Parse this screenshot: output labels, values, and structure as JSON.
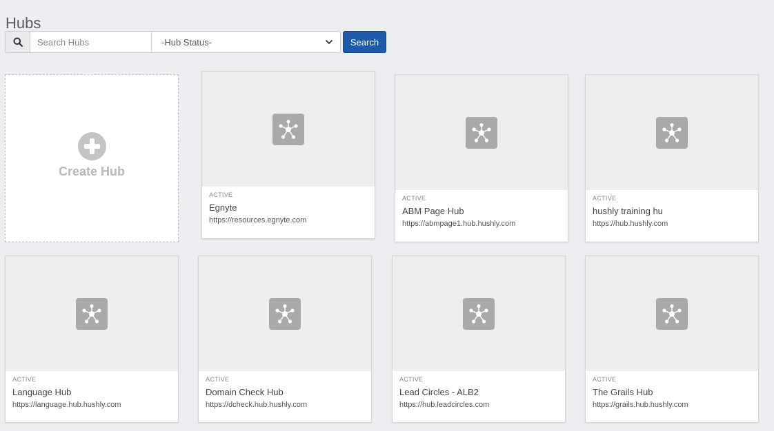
{
  "page": {
    "title": "Hubs"
  },
  "toolbar": {
    "search_icon": "search-icon",
    "search_placeholder": "Search Hubs",
    "search_value": "",
    "status_selected": "-Hub Status-",
    "search_button_label": "Search"
  },
  "create_hub": {
    "icon": "plus-circle-icon",
    "label": "Create Hub"
  },
  "colors": {
    "primary_button": "#1e5aa8",
    "background": "#eceef1",
    "thumb_bg": "#eeeeee",
    "hub_icon_bg": "#a9a9a9"
  },
  "hubs": [
    {
      "status": "ACTIVE",
      "name": "Egnyte",
      "url": "https://resources.egnyte.com",
      "icon": "hub-network-icon"
    },
    {
      "status": "ACTIVE",
      "name": "ABM Page Hub",
      "url": "https://abmpage1.hub.hushly.com",
      "icon": "hub-network-icon"
    },
    {
      "status": "ACTIVE",
      "name": "hushly training hu",
      "url": "https://hub.hushly.com",
      "icon": "hub-network-icon"
    },
    {
      "status": "ACTIVE",
      "name": "Language Hub",
      "url": "https://language.hub.hushly.com",
      "icon": "hub-network-icon"
    },
    {
      "status": "ACTIVE",
      "name": "Domain Check Hub",
      "url": "https://dcheck.hub.hushly.com",
      "icon": "hub-network-icon"
    },
    {
      "status": "ACTIVE",
      "name": "Lead Circles - ALB2",
      "url": "https://hub.leadcircles.com",
      "icon": "hub-network-icon"
    },
    {
      "status": "ACTIVE",
      "name": "The Grails Hub",
      "url": "https://grails.hub.hushly.com",
      "icon": "hub-network-icon"
    }
  ]
}
